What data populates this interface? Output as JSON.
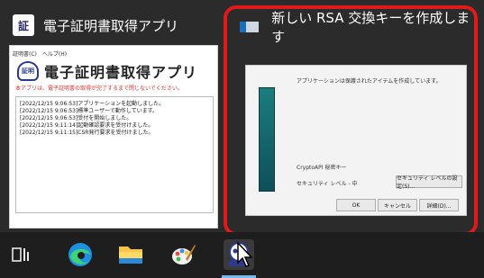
{
  "left_thumbnail": {
    "title": "電子証明書取得アプリ",
    "menu": [
      "証明書(C)",
      "ヘルプ(H)"
    ],
    "brand_title": "電子証明書取得アプリ",
    "warning": "本アプリは、電子証明書の取得が完了するまで閉じないでください。",
    "log_lines": [
      "[2022/12/15 9:06:53]アプリケーションを起動しました。",
      "[2022/12/15 9:06:53]標準ユーザーで動作しています。",
      "[2022/12/15 9:06:53]受付を開始しました。",
      "[2022/12/15 9:11:14]起動確認要求を受付けました。",
      "[2022/12/15 9:11:15]CSR発行要求を受付けました。"
    ]
  },
  "right_thumbnail": {
    "title": "新しい RSA 交換キーを作成します",
    "message": "アプリケーションは保護されたアイテムを作成しています。",
    "csp_label": "CryptoAPI 秘密キー",
    "security_level": "セキュリティ レベル - 中",
    "buttons": {
      "set_security": "セキュリティ レベルの設定(S)...",
      "ok": "OK",
      "cancel": "キャンセル",
      "details": "詳細(D)..."
    },
    "highlight_color": "#e01a1a"
  },
  "taskbar": {
    "items": [
      "task-view-icon",
      "edge-icon",
      "file-explorer-icon",
      "paint-icon",
      "certificate-app-icon"
    ],
    "active": "certificate-app-icon"
  }
}
